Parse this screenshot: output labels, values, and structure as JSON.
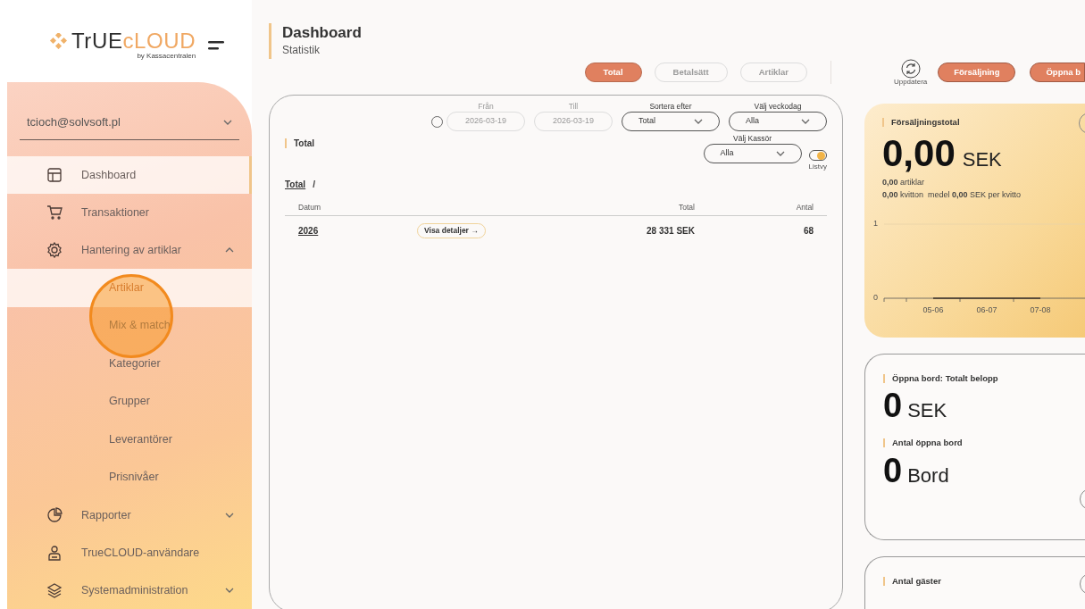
{
  "logo": {
    "parts": [
      "TrUE",
      "cLOUD"
    ],
    "byline": "by Kassacentralen"
  },
  "account": "tcioch@solvsoft.pl",
  "nav": [
    {
      "kind": "link",
      "label": "Dashboard",
      "selected": true
    },
    {
      "kind": "link",
      "label": "Transaktioner",
      "selected": false
    },
    {
      "kind": "group",
      "label": "Hantering av artiklar",
      "selected": false,
      "expanded": true,
      "children": [
        {
          "label": "Artiklar",
          "selected": true
        },
        {
          "label": "Mix & match",
          "selected": false
        },
        {
          "label": "Kategorier",
          "selected": false
        },
        {
          "label": "Grupper",
          "selected": false
        },
        {
          "label": "Leverantörer",
          "selected": false
        },
        {
          "label": "Prisnivåer",
          "selected": false
        }
      ]
    },
    {
      "kind": "group",
      "label": "Rapporter",
      "selected": false,
      "expanded": false
    },
    {
      "kind": "link",
      "label": "TrueCLOUD-användare",
      "selected": false
    },
    {
      "kind": "group",
      "label": "Systemadministration",
      "selected": false,
      "expanded": false
    }
  ],
  "header": {
    "title": "Dashboard",
    "subtitle": "Statistik"
  },
  "view_tabs": [
    {
      "label": "Total",
      "selected": true
    },
    {
      "label": "Betalsätt",
      "selected": false
    },
    {
      "label": "Artiklar",
      "selected": false
    }
  ],
  "refresh_label": "Uppdatera",
  "section_buttons": [
    "Försäljning",
    "Öppna b"
  ],
  "total_panel": {
    "title": "Total",
    "range_enabled": false,
    "date_from": {
      "label": "Från",
      "value": "2026-03-19",
      "disabled": true
    },
    "date_to": {
      "label": "Till",
      "value": "2026-03-19",
      "disabled": true
    },
    "sort": {
      "label": "Sortera efter",
      "value": "Total"
    },
    "weekday": {
      "label": "Välj veckodag",
      "value": "Alla"
    },
    "cashier": {
      "label": "Välj Kassör",
      "value": "Alla"
    },
    "list_view": {
      "label": "Listvy",
      "on": true
    },
    "breadcrumb": "Total",
    "breadcrumb_sep": "/",
    "columns": [
      "Datum",
      "Total",
      "Antal"
    ],
    "rows": [
      {
        "date": "2026",
        "action": "Visa detaljer →",
        "total": "28 331 SEK",
        "count": "68"
      }
    ]
  },
  "sales_card": {
    "title": "Försäljningstotal",
    "amount": "0,00",
    "currency": "SEK",
    "line1": "**0,00** artiklar",
    "line2": "**0,00** kvitton  medel **0,00** SEK per kvitto",
    "chart_data": {
      "type": "line",
      "categories": [
        "05-06",
        "06-07",
        "07-08"
      ],
      "series": [
        {
          "color": "#3a3028",
          "values": [
            0,
            0,
            0
          ]
        }
      ],
      "ylim": [
        0,
        1
      ],
      "yticks": [
        0,
        1
      ]
    }
  },
  "open_tables_card": {
    "metrics": [
      {
        "title": "Öppna bord: Totalt belopp",
        "value": "0",
        "unit": "SEK"
      },
      {
        "title": "Antal öppna bord",
        "value": "0",
        "unit": "Bord"
      }
    ]
  },
  "guests_card": {
    "title": "Antal gäster"
  }
}
